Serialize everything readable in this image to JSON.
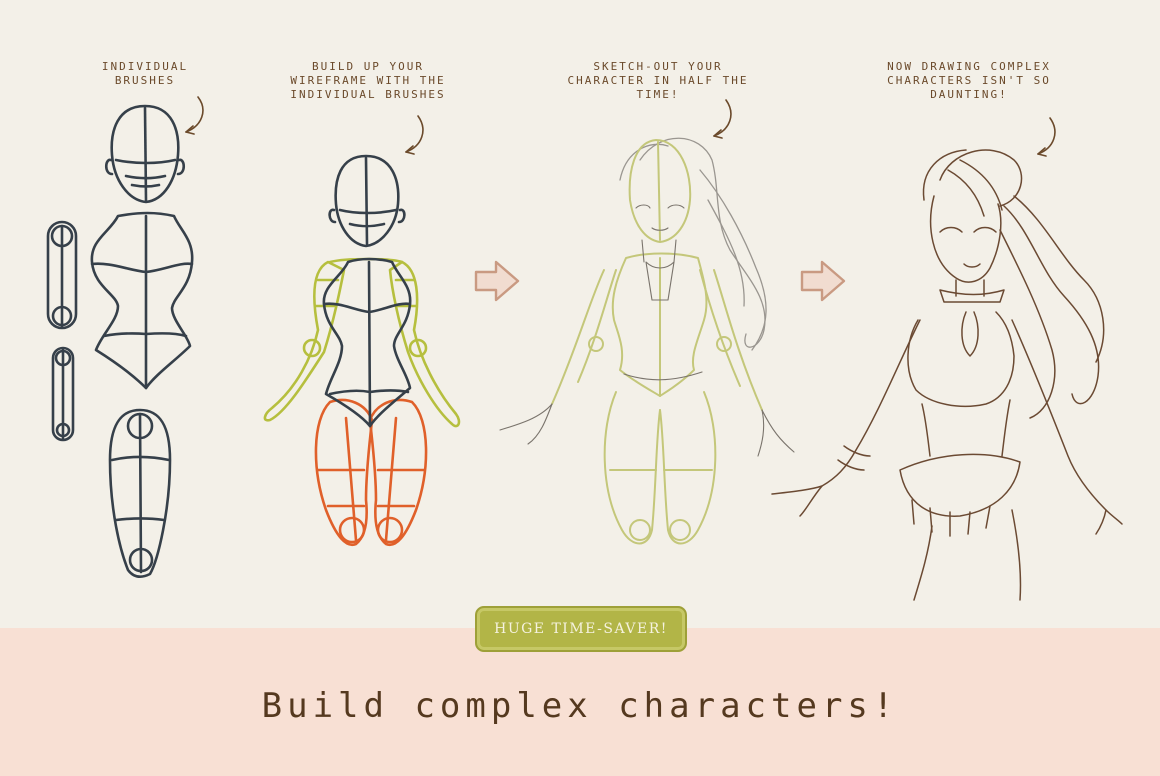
{
  "captions": [
    {
      "lines": [
        "INDIVIDUAL",
        "BRUSHES"
      ]
    },
    {
      "lines": [
        "BUILD UP YOUR",
        "WIREFRAME WITH THE",
        "INDIVIDUAL BRUSHES"
      ]
    },
    {
      "lines": [
        "SKETCH-OUT YOUR",
        "CHARACTER IN HALF THE",
        "TIME!"
      ]
    },
    {
      "lines": [
        "NOW DRAWING COMPLEX",
        "CHARACTERS ISN'T SO",
        "DAUNTING!"
      ]
    }
  ],
  "badge": {
    "label": "HUGE TIME-SAVER!"
  },
  "headline": {
    "text": "Build complex characters!"
  },
  "colors": {
    "ink": "#36404a",
    "lime": "#b6bf3e",
    "orange": "#e0602a",
    "sepia": "#6b4a33",
    "caption": "#6b4a2b",
    "arrow": "#c99a82",
    "band": "#f8e0d4"
  }
}
